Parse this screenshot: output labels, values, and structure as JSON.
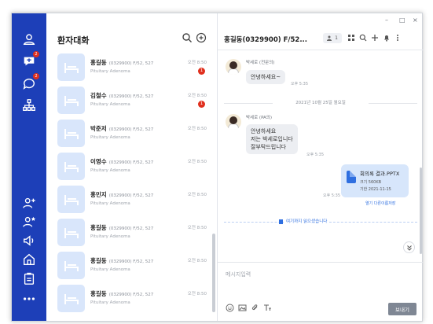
{
  "colors": {
    "rail": "#1d3fb8",
    "accent": "#2f6fe0",
    "badge": "#e0301e",
    "avatar_bg": "#d9e6fb",
    "file_bg": "#d7e6fb"
  },
  "rail": {
    "badges": [
      "2",
      "2"
    ]
  },
  "list": {
    "title": "환자대화",
    "rows": [
      {
        "name": "홍길동",
        "meta": "(0329900) F/52, 527",
        "sub": "Pituitary Adenoma",
        "time": "오전 8:50",
        "badge": "1"
      },
      {
        "name": "김철수",
        "meta": "(0329900) F/52, 527",
        "sub": "Pituitary Adenoma",
        "time": "오전 8:50",
        "badge": "1"
      },
      {
        "name": "박준저",
        "meta": "(0329900) F/52, 527",
        "sub": "Pituitary Adenoma",
        "time": "오전 8:50",
        "badge": ""
      },
      {
        "name": "이영수",
        "meta": "(0329900) F/52, 527",
        "sub": "Pituitary Adenoma",
        "time": "오전 8:50",
        "badge": ""
      },
      {
        "name": "홍민지",
        "meta": "(0329900) F/52, 527",
        "sub": "Pituitary Adenoma",
        "time": "오전 8:50",
        "badge": ""
      },
      {
        "name": "홍길동",
        "meta": "(0329900) F/52, 527",
        "sub": "Pituitary Adenoma",
        "time": "오전 8:50",
        "badge": ""
      },
      {
        "name": "홍길동",
        "meta": "(0329900) F/52, 527",
        "sub": "Pituitary Adenoma",
        "time": "오전 8:50",
        "badge": ""
      },
      {
        "name": "홍길동",
        "meta": "(0329900) F/52, 527",
        "sub": "Pituitary Adenoma",
        "time": "오전 8:50",
        "badge": ""
      }
    ]
  },
  "chat": {
    "window_controls": {
      "minimize": "–",
      "maximize": "□",
      "close": "×"
    },
    "title": "홍길동(0329900) F/52...",
    "member_count": "1",
    "messages": [
      {
        "sender": "박세로 (전문의)",
        "text": "안녕하세요~",
        "time": "오후 5:35"
      },
      {
        "sender": "박세로 (PA의)",
        "lines": [
          "안녕하세요",
          "저는 박세로입니다",
          "잘부탁드립니다"
        ],
        "time": "오후 5:35"
      }
    ],
    "date_separator": "2021년 10월 25일 월요일",
    "file": {
      "time": "오후 5:35",
      "name": "회의록 결과.PPTX",
      "size": "크기 560KB",
      "expiry": "기한 2021-11-15",
      "actions": "열기   다른이름저장"
    },
    "notice": "여기까지 읽으셨습니다",
    "input_placeholder": "메시지입력",
    "send_label": "보내기"
  }
}
